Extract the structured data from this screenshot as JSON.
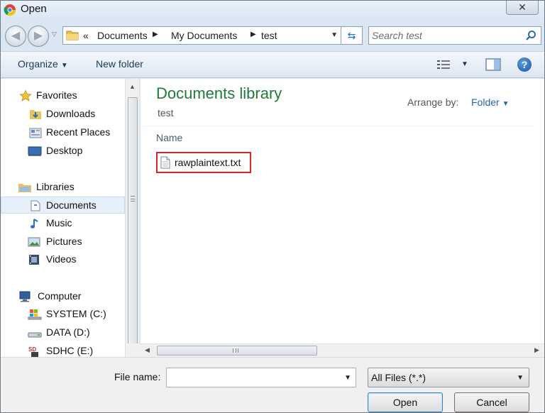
{
  "window": {
    "title": "Open",
    "close_symbol": "✕"
  },
  "address_bar": {
    "overflow_symbol": "«",
    "crumbs": [
      "Documents",
      "My Documents",
      "test"
    ]
  },
  "search": {
    "placeholder": "Search test"
  },
  "toolbar": {
    "organize_label": "Organize",
    "new_folder_label": "New folder",
    "help_symbol": "?"
  },
  "nav_pane": {
    "favorites": {
      "label": "Favorites",
      "items": [
        "Downloads",
        "Recent Places",
        "Desktop"
      ]
    },
    "libraries": {
      "label": "Libraries",
      "items": [
        "Documents",
        "Music",
        "Pictures",
        "Videos"
      ],
      "selected": "Documents"
    },
    "computer": {
      "label": "Computer",
      "items": [
        "SYSTEM (C:)",
        "DATA (D:)",
        "SDHC (E:)"
      ]
    }
  },
  "content": {
    "library_title": "Documents library",
    "library_subtitle": "test",
    "arrange_by_label": "Arrange by:",
    "arrange_by_value": "Folder",
    "column_name": "Name",
    "files": [
      {
        "name": "rawplaintext.txt",
        "highlighted": true
      }
    ]
  },
  "footer": {
    "file_name_label": "File name:",
    "file_name_value": "",
    "file_type_value": "All Files (*.*)",
    "open_label": "Open",
    "cancel_label": "Cancel"
  },
  "colors": {
    "library_title": "#1f7a3a",
    "link_blue": "#2364b4",
    "highlight_border": "#d8262a",
    "selected_nav": "#e5f0fb"
  }
}
